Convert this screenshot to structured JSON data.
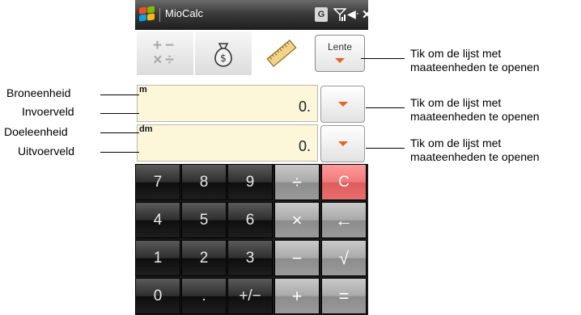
{
  "titlebar": {
    "app_title": "MioCalc",
    "g_icon_label": "G"
  },
  "modes": [
    {
      "name": "calculator",
      "icon": "calculator-icon"
    },
    {
      "name": "currency",
      "icon": "money-bag-icon"
    },
    {
      "name": "units",
      "icon": "ruler-icon"
    }
  ],
  "category_dropdown": {
    "label": "Lente"
  },
  "input_field": {
    "unit": "m",
    "value": "0."
  },
  "output_field": {
    "unit": "dm",
    "value": "0."
  },
  "keypad": {
    "rows": [
      [
        "7",
        "8",
        "9",
        "÷",
        "C"
      ],
      [
        "4",
        "5",
        "6",
        "×",
        "←"
      ],
      [
        "1",
        "2",
        "3",
        "−",
        "√"
      ],
      [
        "0",
        ".",
        "+/−",
        "+",
        "="
      ]
    ]
  },
  "callouts": {
    "left": [
      "Broneenheid",
      "Invoerveld",
      "Doeleenheid",
      "Uitvoerveld"
    ],
    "right": [
      [
        "Tik om de lijst met",
        "maateenheden te openen"
      ],
      [
        "Tik om de lijst met",
        "maateenheden te openen"
      ],
      [
        "Tik om de lijst met",
        "maateenheden te openen"
      ]
    ]
  },
  "colors": {
    "accent": "#e8621a",
    "field_bg": "#fbf7d8",
    "clear_key": "#f07a7a"
  }
}
